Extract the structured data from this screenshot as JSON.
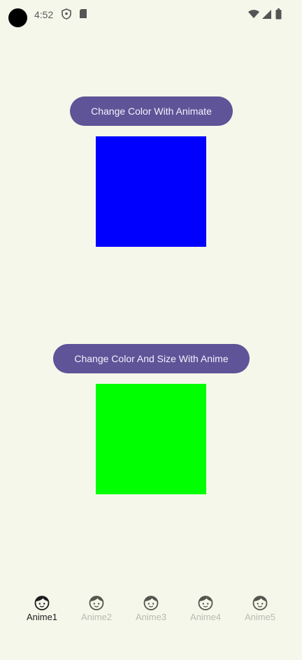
{
  "status_bar": {
    "time": "4:52",
    "icons": [
      "shield-icon",
      "sd-card-icon",
      "wifi-icon",
      "signal-icon",
      "battery-icon"
    ]
  },
  "buttons": {
    "animate_color": "Change Color With Animate",
    "animate_color_size": "Change Color And Size With Anime"
  },
  "boxes": {
    "first_color": "#0000ff",
    "second_color": "#00ff00"
  },
  "bottom_nav": {
    "items": [
      {
        "label": "Anime1",
        "icon": "face-icon",
        "active": true
      },
      {
        "label": "Anime2",
        "icon": "face-icon",
        "active": false
      },
      {
        "label": "Anime3",
        "icon": "face-icon",
        "active": false
      },
      {
        "label": "Anime4",
        "icon": "face-icon",
        "active": false
      },
      {
        "label": "Anime5",
        "icon": "face-icon",
        "active": false
      }
    ]
  }
}
